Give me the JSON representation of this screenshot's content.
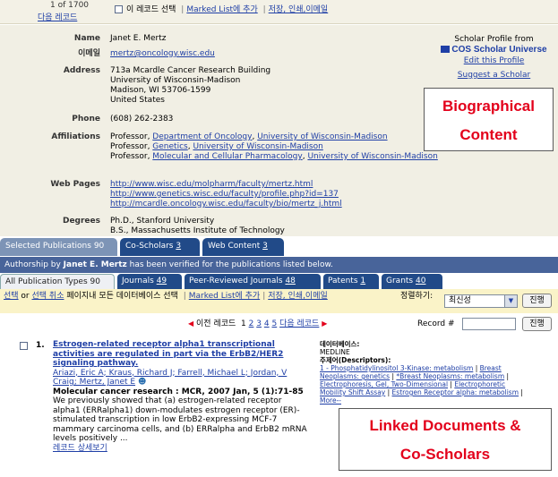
{
  "top": {
    "record_count": "1 of 1700",
    "next_record": "다음 레코드",
    "select_record": "이 레코드 선택",
    "add_to_marked": "Marked List에 추가",
    "save_print": "저장, 인쇄,이메일"
  },
  "bio": {
    "fields": [
      {
        "label": "Name",
        "lines": [
          "Janet E. Mertz"
        ],
        "link": false
      },
      {
        "label": "이메일",
        "lines": [
          "mertz@oncology.wisc.edu"
        ],
        "link": true
      },
      {
        "label": "Address",
        "lines": [
          "713a Mcardle Cancer Research Building",
          "University of Wisconsin-Madison",
          "Madison, WI 53706-1599",
          "United States"
        ],
        "link": false
      },
      {
        "label": "Phone",
        "lines": [
          "(608) 262-2383"
        ],
        "link": false
      },
      {
        "label": "Affiliations",
        "lines": [],
        "link": false
      },
      {
        "label": "Web Pages",
        "lines": [
          "http://www.wisc.edu/molpharm/faculty/mertz.html",
          "http://www.genetics.wisc.edu/faculty/profile.php?id=137",
          "http://mcardle.oncology.wisc.edu/faculty/bio/mertz_j.html"
        ],
        "link": true
      },
      {
        "label": "Degrees",
        "lines": [
          "Ph.D., Stanford University",
          "B.S., Massachusetts Institute of Technology"
        ],
        "link": false
      }
    ],
    "affiliations": [
      {
        "prefix": "Professor, ",
        "dept": "Department of Oncology",
        "inst": "University of Wisconsin-Madison"
      },
      {
        "prefix": "Professor, ",
        "dept": "Genetics",
        "inst": "University of Wisconsin-Madison"
      },
      {
        "prefix": "Professor, ",
        "dept": "Molecular and Cellular Pharmacology",
        "inst": "University of Wisconsin-Madison"
      }
    ],
    "profile": {
      "header": "Scholar Profile from",
      "logo": "COS Scholar Universe",
      "edit": "Edit this Profile",
      "suggest": "Suggest a Scholar"
    }
  },
  "callouts": {
    "bio_line1": "Biographical",
    "bio_line2": "Content",
    "linked_line1": "Linked Documents &",
    "linked_line2": "Co-Scholars"
  },
  "tabs": [
    {
      "label": "Selected Publications 90",
      "active": true
    },
    {
      "label": "Co-Scholars ",
      "count": "3",
      "active": false
    },
    {
      "label": "Web Content ",
      "count": "3",
      "active": false
    }
  ],
  "authorship": {
    "before": "Authorship by ",
    "name": "Janet E. Mertz",
    "after": " has been verified for the publications listed below."
  },
  "subtabs": [
    {
      "label": "All Publication Types 90",
      "active": true
    },
    {
      "label": "Journals ",
      "count": "49",
      "active": false
    },
    {
      "label": "Peer-Reviewed Journals ",
      "count": "48",
      "active": false
    },
    {
      "label": "Patents ",
      "count": "1",
      "active": false
    },
    {
      "label": "Grants ",
      "count": "40",
      "active": false
    }
  ],
  "actions": {
    "select": "선택",
    "or": " or ",
    "deselect": "선택 취소",
    "page_all": " 페이지내 모든 데이터베이스 선택 ",
    "add_marked": "Marked List에 추가",
    "save_print": "저장, 인쇄,이메일",
    "sort_label": "정렬하기:",
    "sort_value": "최신성",
    "go": "진행"
  },
  "pager": {
    "prev": "이전 레코드",
    "current": "1",
    "pages": [
      "2",
      "3",
      "4",
      "5"
    ],
    "next": "다음 레코드",
    "record_label": "Record #",
    "go": "진행"
  },
  "result": {
    "number": "1.",
    "title": "Estrogen-related receptor alpha1 transcriptional activities are regulated in part via the ErbB2/HER2 signaling pathway.",
    "authors": "Ariazi, Eric A; Kraus, Richard J; Farrell, Michael L; Jordan, V Craig; Mertz, Janet E",
    "source": "Molecular cancer research : MCR, 2007 Jan, 5 (1):71-85",
    "abstract": "We previously showed that (a) estrogen-related receptor alpha1 (ERRalpha1) down-modulates estrogen receptor (ER)-stimulated transcription in low ErbB2-expressing MCF-7 mammary carcinoma cells, and (b) ERRalpha and ErbB2 mRNA levels positively ...",
    "details": "레코드 상세보기",
    "db_label": "데이터베이스:",
    "db_value": "MEDLINE",
    "subject_label": "주제어(Descriptors):",
    "descriptors": [
      "1 - Phosphatidylinositol 3-Kinase: metabolism",
      "Breast Neoplasms: genetics",
      "*Breast Neoplasms: metabolism",
      "Electrophoresis, Gel, Two-Dimensional",
      "Electrophoretic Mobility Shift Assay",
      "Estrogen Receptor alpha: metabolism",
      "More--"
    ]
  }
}
